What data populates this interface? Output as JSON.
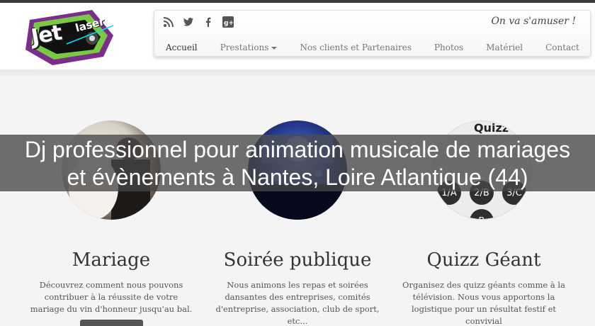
{
  "brand": {
    "logo_word_1": "Jet",
    "logo_word_2": "laser"
  },
  "header": {
    "tagline": "On va s'amuser !",
    "social_icons": [
      "rss-icon",
      "twitter-icon",
      "facebook-icon",
      "google-plus-icon"
    ]
  },
  "nav": {
    "items": [
      {
        "label": "Accueil"
      },
      {
        "label": "Prestations"
      },
      {
        "label": "Nos clients et Partenaires"
      },
      {
        "label": "Photos"
      },
      {
        "label": "Matériel"
      },
      {
        "label": "Contact"
      }
    ]
  },
  "headline": {
    "line1": "Dj professionnel pour animation musicale de mariages",
    "line2": "et évènements à Nantes, Loire Atlantique (44)"
  },
  "features": [
    {
      "title": "Mariage",
      "text": "Découvrez comment nous pouvons contribuer à la réussite de votre mariage du vin d'honneur jusqu'au bal."
    },
    {
      "title": "Soirée publique",
      "text": "Nous animons les repas et soirées dansantes des entreprises, comités d'entreprise, association, club de sport, etc..."
    },
    {
      "title": "Quizz Géant",
      "text": "Organisez des quizz géants comme à la télévision. Nous vous apportons la logistique pour un résultat festif et convivial",
      "image_text": "Quizz",
      "image_buttons": [
        "1/A",
        "2/B",
        "3/C",
        "B"
      ]
    }
  ],
  "colors": {
    "topbar": "#3a3a3a",
    "overlay": "rgba(70,70,70,0.78)",
    "logo_green": "#7ac943",
    "logo_purple": "#7b2d8e"
  }
}
